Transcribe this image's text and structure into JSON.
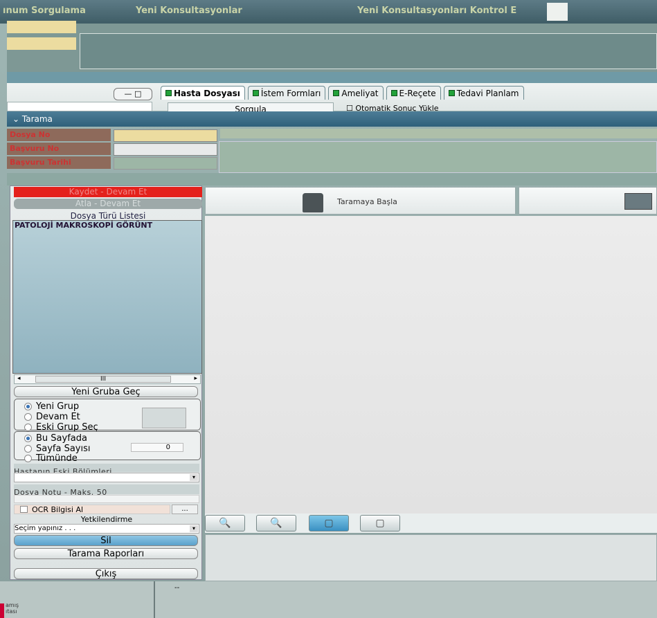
{
  "topbar": {
    "items": [
      "ınum Sorgulama",
      "Yeni Konsultasyonlar",
      "Yeni Konsultasyonları Kontrol E"
    ]
  },
  "tabs": {
    "items": [
      "Hasta Dosyası",
      "İstem Formları",
      "Ameliyat",
      "E-Reçete",
      "Tedavi Planlam"
    ],
    "window_btn": "— □",
    "sorgula": "Sorgula",
    "oto_label": "Otomatik Sonuç Yükle"
  },
  "tarama": {
    "title": "Tarama",
    "fields": [
      {
        "label": "Dosya No",
        "value": ""
      },
      {
        "label": "Başvuru No",
        "value": ""
      },
      {
        "label": "Başvuru Tarihi",
        "value": ""
      }
    ]
  },
  "left": {
    "kaydet": "Kaydet - Devam Et",
    "atla": "Atla - Devam Et",
    "list_header": "Dosya Türü Listesi",
    "list_items": [
      "PATOLOJİ MAKROSKOPİ GÖRÜNT"
    ],
    "scroll_grip": "III",
    "yeni_gruba": "Yeni Gruba Geç",
    "group1": [
      "Yeni Grup",
      "Devam Et",
      "Eski Grup Seç"
    ],
    "group2": [
      "Bu Sayfada",
      "Sayfa Sayısı",
      "Tümünde"
    ],
    "sayfa_value": "0",
    "eski_bolumler": "Hastanın Eski Bölümleri",
    "dosya_notu": "Dosya Notu - Maks. 50",
    "ocr": "OCR Bilgisi Al",
    "ocr_btn": "...",
    "yetkilendirme": "Yetkilendirme",
    "secim": "Seçim yapınız . . .",
    "sil": "Sil",
    "raporlar": "Tarama Raporları",
    "cikis": "Çıkış"
  },
  "main": {
    "scan_label": "Taramaya Başla",
    "zoom": [
      "zoom-in",
      "zoom-out",
      "fit-page",
      "actual-size"
    ]
  },
  "footer": {
    "left_text": "amış\nıtası",
    "dash": "--"
  }
}
